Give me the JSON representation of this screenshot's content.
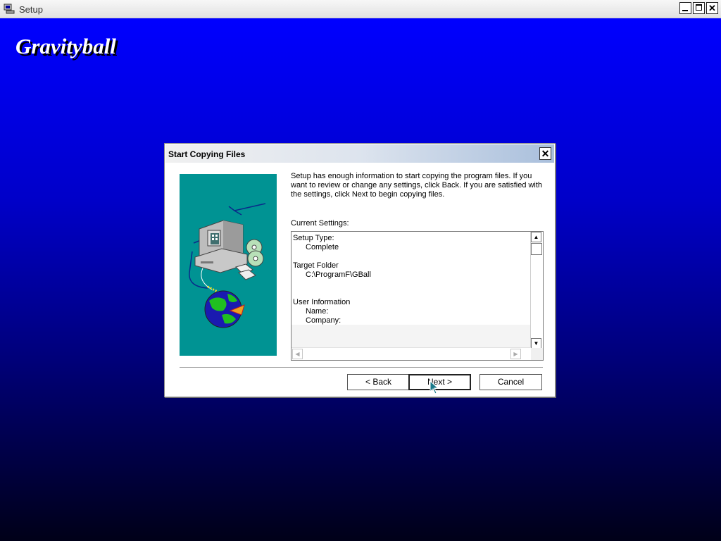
{
  "window": {
    "title": "Setup",
    "controls": [
      "minimize-icon",
      "maximize-icon",
      "close-icon"
    ],
    "close_glyph": "✕"
  },
  "brand": {
    "text": "Gravityball"
  },
  "dialog": {
    "title": "Start Copying Files",
    "close_glyph": "✕",
    "intro": "Setup has enough information to start copying the program files.  If you want to review or change any settings, click Back.  If you are satisfied with the settings, click Next to begin copying files.",
    "current_settings_label": "Current Settings:",
    "settings": {
      "setup_type_label": "Setup Type:",
      "setup_type_value": "Complete",
      "target_folder_label": "Target Folder",
      "target_folder_value": "C:\\ProgramF\\GBall",
      "user_info_label": "User Information",
      "name_label": "Name:",
      "company_label": "Company:"
    },
    "buttons": {
      "back": "< Back",
      "next": "Next >",
      "cancel": "Cancel"
    }
  },
  "colors": {
    "desktop_top": "#0000ff",
    "desktop_bottom": "#000018",
    "art_background": "#009393"
  }
}
